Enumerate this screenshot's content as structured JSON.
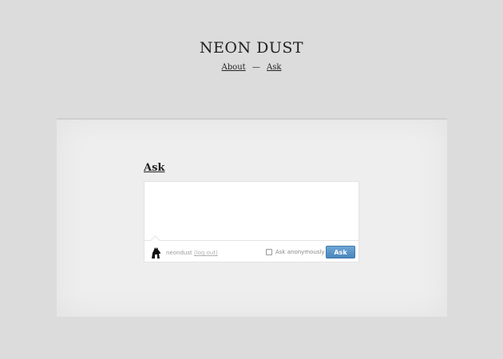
{
  "site": {
    "title": "NEON DUST"
  },
  "nav": {
    "about_label": "About",
    "separator": "—",
    "ask_label": "Ask"
  },
  "ask": {
    "heading": "Ask",
    "textarea_value": "",
    "username": "neondust",
    "logout_label": "(log out)",
    "anonymous_label": "Ask anonymously",
    "anonymous_checked": false,
    "submit_label": "Ask",
    "submit_color": "#5a94c8"
  },
  "icons": {
    "avatar": "horse-head-avatar-icon",
    "checkbox": "checkbox-icon"
  }
}
